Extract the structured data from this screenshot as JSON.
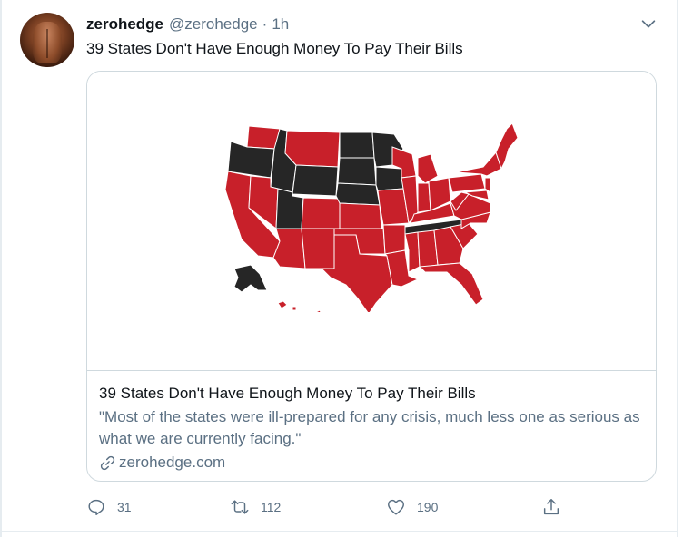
{
  "tweet": {
    "display_name": "zerohedge",
    "handle": "@zerohedge",
    "separator": "·",
    "time": "1h",
    "text": "39 States Don't Have Enough Money To Pay Their Bills"
  },
  "card": {
    "title": "39 States Don't Have Enough Money To Pay Their Bills",
    "description": "\"Most of the states were ill-prepared for any crisis, much less one as serious as what we are currently facing.\"",
    "domain": "zerohedge.com",
    "map_colors": {
      "insufficient": "#c8202a",
      "sufficient": "#262626",
      "border": "#ffffff"
    }
  },
  "actions": {
    "replies": "31",
    "retweets": "112",
    "likes": "190"
  },
  "icons": [
    "chevron-down-icon",
    "reply-icon",
    "retweet-icon",
    "like-icon",
    "share-icon",
    "link-icon"
  ]
}
